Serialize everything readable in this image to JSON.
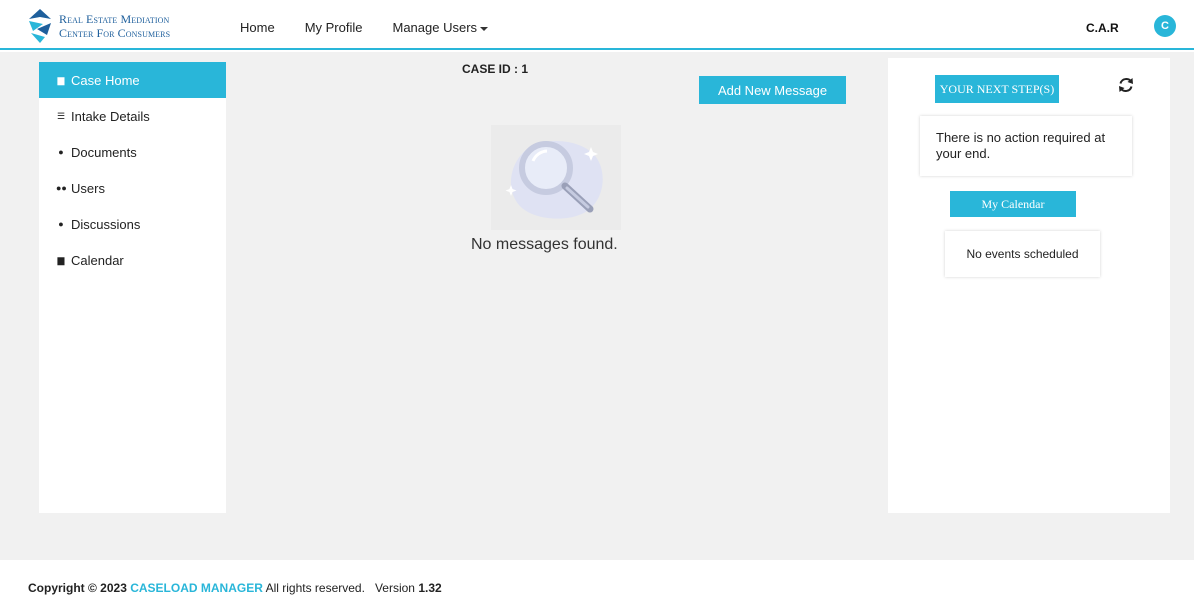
{
  "header": {
    "logo_line1": "Real Estate Mediation",
    "logo_line2": "Center For Consumers",
    "nav": [
      "Home",
      "My Profile",
      "Manage Users"
    ],
    "user_name": "C.A.R",
    "avatar_letter": "C"
  },
  "sidebar": {
    "items": [
      {
        "label": "Case Home",
        "icon": "file-icon"
      },
      {
        "label": "Intake Details",
        "icon": "list-icon"
      },
      {
        "label": "Documents",
        "icon": "paperclip-icon"
      },
      {
        "label": "Users",
        "icon": "users-icon"
      },
      {
        "label": "Discussions",
        "icon": "comment-icon"
      },
      {
        "label": "Calendar",
        "icon": "calendar-icon"
      }
    ]
  },
  "main": {
    "case_id": "CASE ID : 1",
    "add_button": "Add New Message",
    "empty_text": "No messages found."
  },
  "right": {
    "next_step_button": "YOUR NEXT STEP(S)",
    "action_text": "There is no action required at your end.",
    "calendar_button": "My Calendar",
    "events_text": "No events scheduled"
  },
  "footer": {
    "copyright": "Copyright © 2023",
    "brand": "CASELOAD MANAGER",
    "rights": "All rights reserved.",
    "version_label": "Version",
    "version": "1.32"
  },
  "colors": {
    "accent": "#29b6d9",
    "logo": "#1e5f9c",
    "background": "#f1f1f1"
  }
}
